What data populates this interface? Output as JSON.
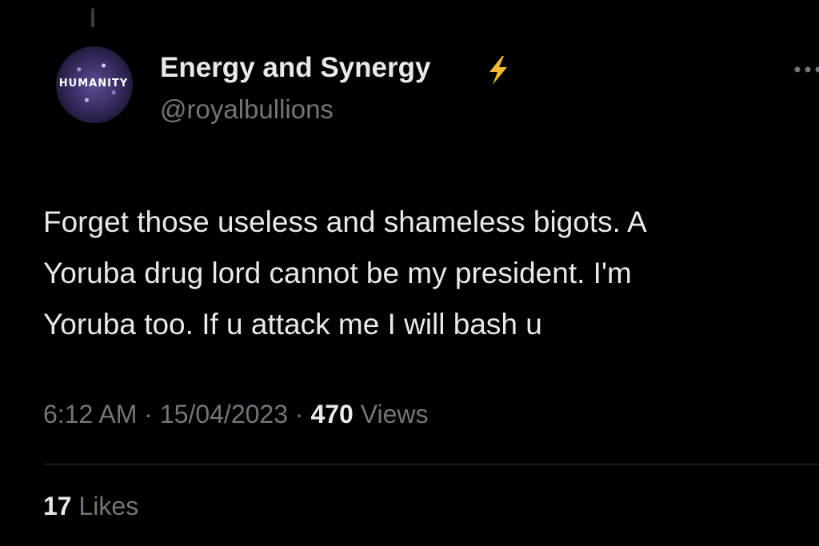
{
  "tweet": {
    "author": {
      "display_name": "Energy and Synergy",
      "badge_icon": "lightning-bolt-icon",
      "handle": "@royalbullions",
      "avatar_text": "HUMANITY"
    },
    "text": "Forget those useless and shameless bigots. A\nYoruba drug lord cannot be my president. I'm\nYoruba too. If u attack me I will bash u",
    "time": "6:12 AM",
    "separator": "·",
    "date": "15/04/2023",
    "views_count": "470",
    "views_label": "Views",
    "likes_count": "17",
    "likes_label": "Likes"
  },
  "colors": {
    "background": "#000000",
    "primary_text": "#e7e9ea",
    "secondary_text": "#71767b",
    "bolt": "#f5b82e",
    "divider": "#2f3336"
  }
}
